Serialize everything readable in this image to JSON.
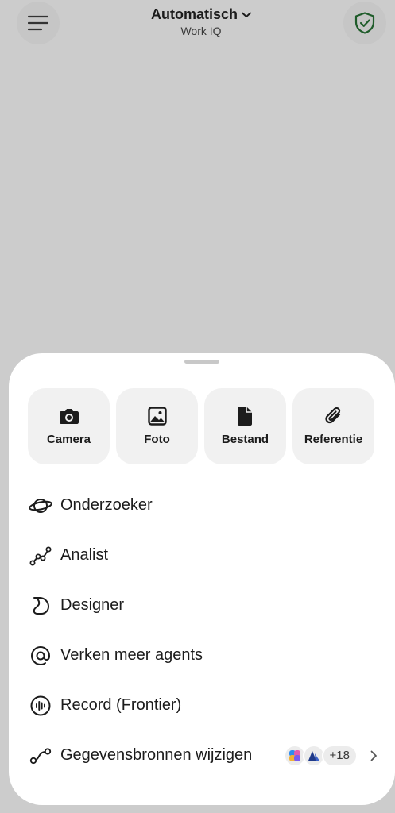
{
  "header": {
    "title": "Automatisch",
    "subtitle": "Work IQ",
    "menu_icon": "hamburger-menu-icon",
    "shield_icon": "shield-check-icon",
    "shield_color": "#1f5c2a"
  },
  "sheet": {
    "tiles": [
      {
        "label": "Camera",
        "icon": "camera-icon"
      },
      {
        "label": "Foto",
        "icon": "photo-icon"
      },
      {
        "label": "Bestand",
        "icon": "file-icon"
      },
      {
        "label": "Referentie",
        "icon": "paperclip-icon"
      }
    ],
    "items": [
      {
        "label": "Onderzoeker",
        "icon": "planet-icon"
      },
      {
        "label": "Analist",
        "icon": "analytics-line-icon"
      },
      {
        "label": "Designer",
        "icon": "designer-icon"
      },
      {
        "label": "Verken meer agents",
        "icon": "at-sign-icon"
      },
      {
        "label": "Record (Frontier)",
        "icon": "waveform-icon"
      },
      {
        "label": "Gegevensbronnen wijzigen",
        "icon": "data-sources-icon"
      }
    ],
    "sources_count": "+18"
  }
}
